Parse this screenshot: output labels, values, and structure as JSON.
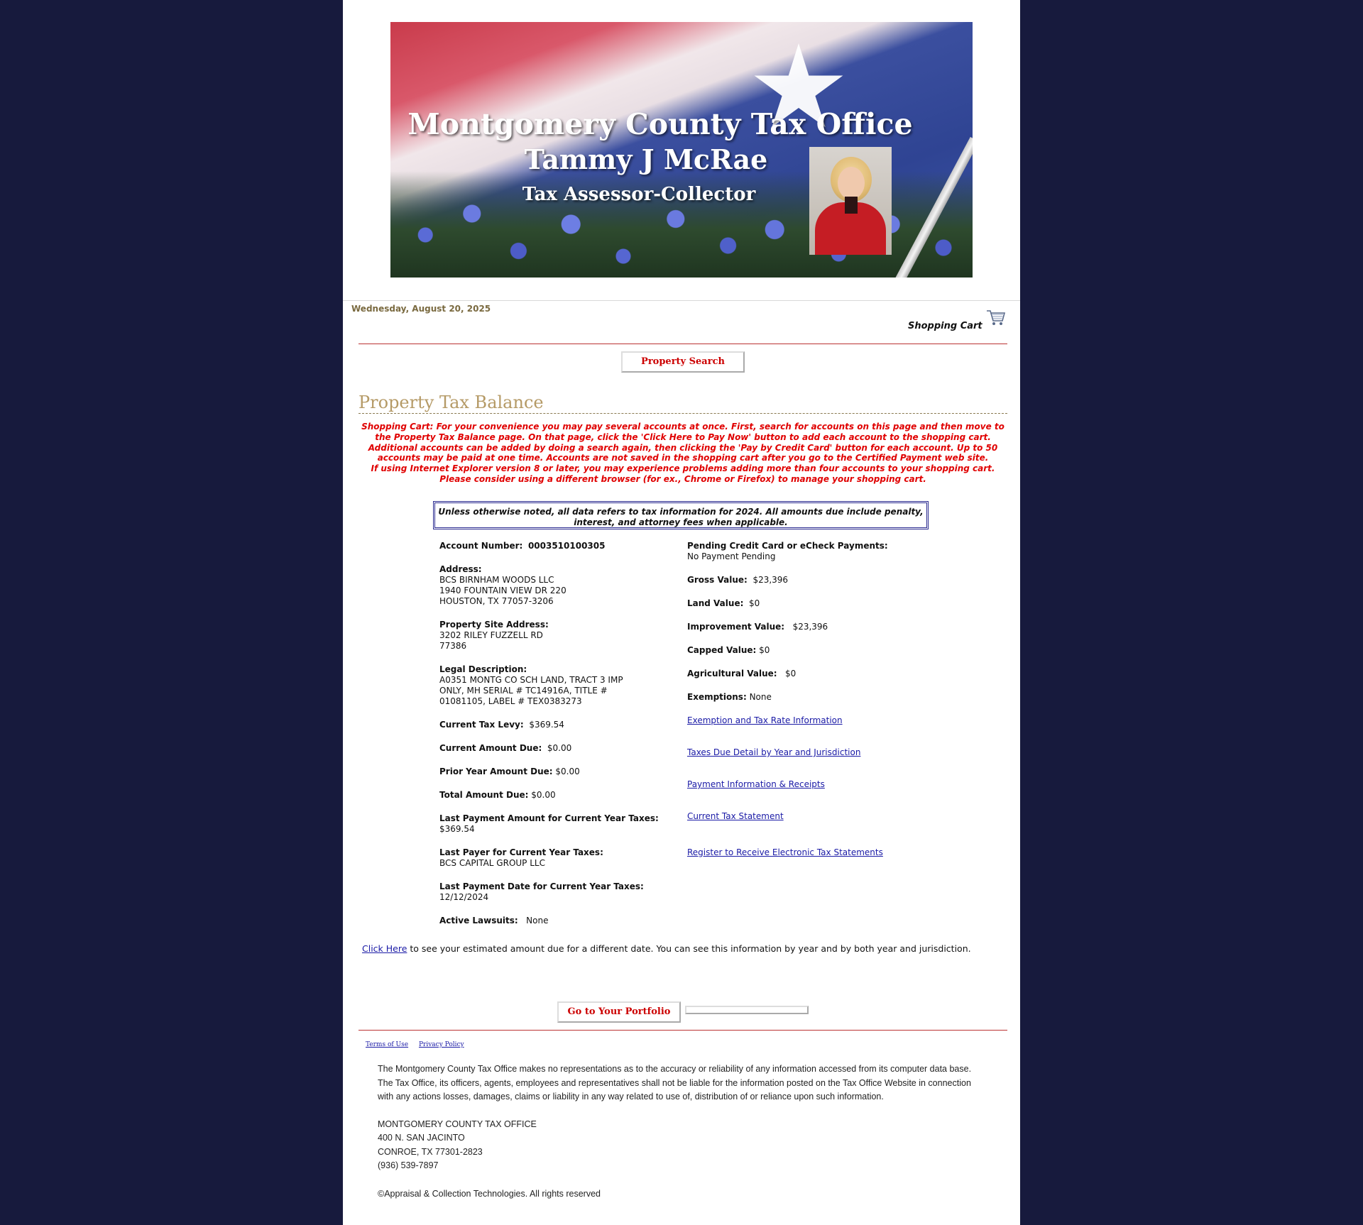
{
  "banner": {
    "title": "Montgomery County Tax Office",
    "name": "Tammy J McRae",
    "role": "Tax Assessor-Collector"
  },
  "header": {
    "date": "Wednesday, August 20, 2025",
    "cart_label": "Shopping Cart"
  },
  "nav": {
    "property_search": "Property Search"
  },
  "page_title": "Property Tax Balance",
  "notice_lines": [
    "Shopping Cart: For your convenience you may pay several accounts at once. First, search for accounts on this page and then move to",
    "the Property Tax Balance page. On that page, click the 'Click Here to Pay Now' button to add each account to the shopping cart.",
    "Additional accounts can be added by doing a search again, then clicking the 'Pay by Credit Card' button for each account. Up to 50",
    "accounts may be paid at one time. Accounts are not saved in the shopping cart after you go to the Certified Payment web site.",
    "If using Internet Explorer version 8 or later, you may experience problems adding more than four accounts to your shopping cart.",
    "Please consider using a different browser (for ex., Chrome or Firefox) to manage your shopping cart."
  ],
  "infobox": {
    "line1": "Unless otherwise noted, all data refers to tax information for 2024. All amounts due include penalty,",
    "line2": "interest, and attorney fees when applicable."
  },
  "account": {
    "number_label": "Account Number:",
    "number": "0003510100305",
    "address_label": "Address:",
    "address": [
      "BCS BIRNHAM WOODS LLC",
      "1940 FOUNTAIN VIEW DR 220",
      "HOUSTON, TX 77057-3206"
    ],
    "site_label": "Property Site Address:",
    "site": [
      "3202 RILEY FUZZELL RD",
      "77386"
    ],
    "legal_label": "Legal Description:",
    "legal": [
      "A0351 MONTG CO SCH LAND, TRACT 3 IMP",
      "ONLY, MH SERIAL # TC14916A, TITLE #",
      "01081105, LABEL # TEX0383273"
    ],
    "levy_label": "Current Tax Levy:",
    "levy": "$369.54",
    "current_due_label": "Current Amount Due:",
    "current_due": "$0.00",
    "prior_due_label": "Prior Year Amount Due:",
    "prior_due": "$0.00",
    "total_due_label": "Total Amount Due:",
    "total_due": "$0.00",
    "last_payment_label": "Last Payment Amount for Current Year Taxes:",
    "last_payment": "$369.54",
    "last_payer_label": "Last Payer for Current Year Taxes:",
    "last_payer": "BCS CAPITAL GROUP LLC",
    "last_date_label": "Last Payment Date for Current Year Taxes:",
    "last_date": "12/12/2024",
    "lawsuits_label": "Active Lawsuits:",
    "lawsuits": "None"
  },
  "right": {
    "pending_label": "Pending Credit Card or eCheck Payments:",
    "pending": "No Payment Pending",
    "gross_label": "Gross Value:",
    "gross": "$23,396",
    "land_label": "Land Value:",
    "land": "$0",
    "improvement_label": "Improvement Value:",
    "improvement": "$23,396",
    "capped_label": "Capped Value:",
    "capped": "$0",
    "ag_label": "Agricultural Value:",
    "ag": "$0",
    "exemptions_label": "Exemptions:",
    "exemptions": "None",
    "links": [
      "Exemption and Tax Rate Information",
      "Taxes Due Detail by Year and Jurisdiction",
      "Payment Information & Receipts",
      "Current Tax Statement",
      "Register to Receive Electronic Tax Statements"
    ]
  },
  "estimate": {
    "link": "Click Here",
    "text": " to see your estimated amount due for a different date. You can see this information by year and by both year and jurisdiction."
  },
  "portfolio_button": "Go to Your Portfolio",
  "footer": {
    "terms": "Terms of Use",
    "privacy": "Privacy Policy",
    "disclaimer": [
      "The Montgomery County Tax Office makes no representations as to the accuracy or reliability of any information accessed from its computer data base.",
      "The Tax Office, its officers, agents, employees and representatives shall not be liable for the information posted on the Tax Office Website in connection",
      "with any actions losses, damages, claims or liability in any way related to use of, distribution of or reliance upon such information."
    ],
    "office": [
      "MONTGOMERY COUNTY TAX OFFICE",
      "400 N. SAN JACINTO",
      "CONROE, TX 77301-2823",
      "(936) 539-7897"
    ],
    "copyright": "©Appraisal & Collection Technologies. All rights reserved"
  }
}
